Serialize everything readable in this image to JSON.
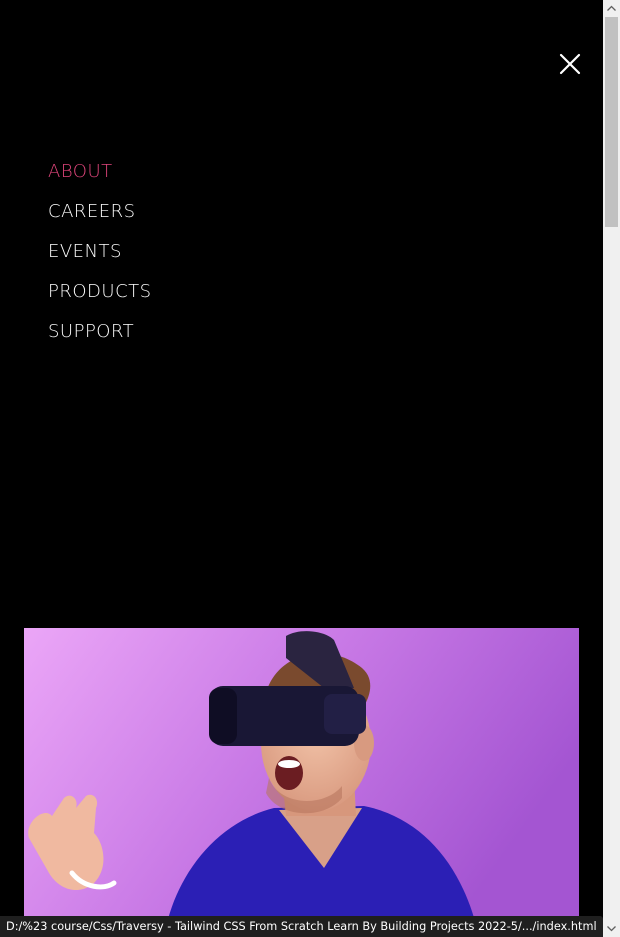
{
  "mobile_menu": {
    "close_icon": "close-icon",
    "nav_items": [
      {
        "label": "ABOUT",
        "active": true
      },
      {
        "label": "CAREERS",
        "active": false
      },
      {
        "label": "EVENTS",
        "active": false
      },
      {
        "label": "PRODUCTS",
        "active": false
      },
      {
        "label": "SUPPORT",
        "active": false
      }
    ]
  },
  "colors": {
    "background": "#000000",
    "nav_text": "#ffffff",
    "nav_active": "#e0457b",
    "hero_gradient_light": "#e6a3f5",
    "hero_gradient_dark": "#9f4fd1",
    "shirt": "#2a1fb8"
  },
  "hero": {
    "icon": "vr-headset-person-image"
  },
  "status_bar": {
    "url": "D:/%23 course/Css/Traversy - Tailwind CSS From Scratch Learn By Building Projects 2022-5/.../index.html"
  }
}
